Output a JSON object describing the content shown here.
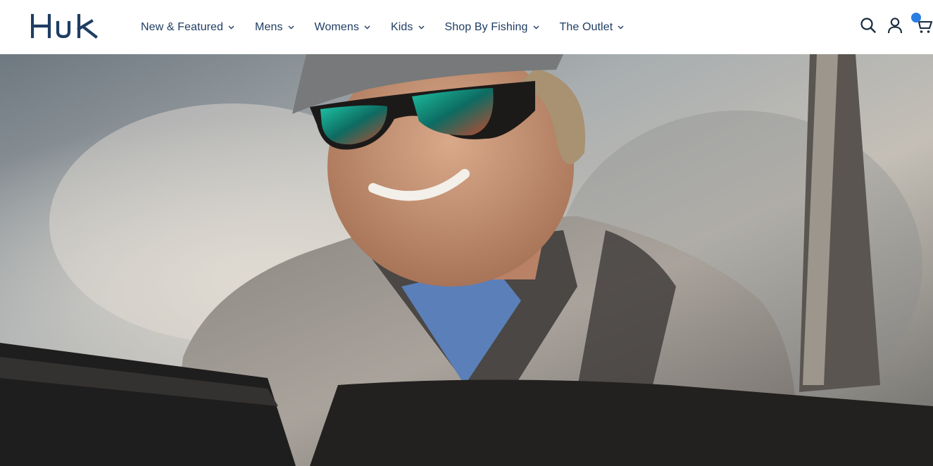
{
  "brand": {
    "logo_text": "Huk",
    "color": "#1f3d63"
  },
  "nav": {
    "items": [
      {
        "label": "New & Featured"
      },
      {
        "label": "Mens"
      },
      {
        "label": "Womens"
      },
      {
        "label": "Kids"
      },
      {
        "label": "Shop By Fishing"
      },
      {
        "label": "The Outlet"
      }
    ]
  },
  "header_icons": {
    "search": "search-icon",
    "account": "account-icon",
    "cart": "cart-icon",
    "cart_badge_color": "#2a7de1"
  },
  "hero": {
    "image": "angler-in-sunglasses-on-boat"
  }
}
